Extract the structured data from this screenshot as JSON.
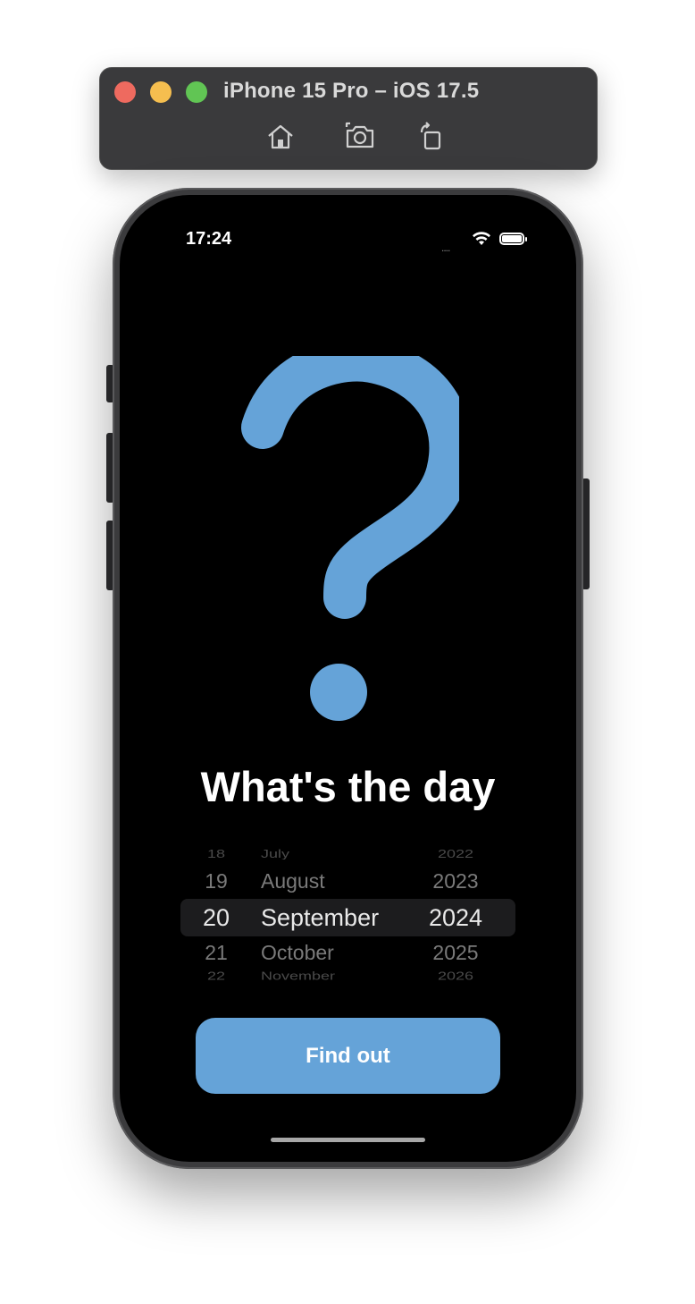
{
  "simulator": {
    "title": "iPhone 15 Pro – iOS 17.5",
    "toolbar": [
      "home-icon",
      "screenshot-icon",
      "rotate-icon"
    ]
  },
  "status_bar": {
    "time": "17:24",
    "signal_dots": "....",
    "icons": [
      "wifi-icon",
      "battery-icon"
    ]
  },
  "main": {
    "hero_icon": "question-mark-icon",
    "accent_color": "#65a3d8",
    "title": "What's the day",
    "button_label": "Find out"
  },
  "date_picker": {
    "rows": [
      {
        "day": "18",
        "month": "July",
        "year": "2022"
      },
      {
        "day": "19",
        "month": "August",
        "year": "2023"
      },
      {
        "day": "20",
        "month": "September",
        "year": "2024"
      },
      {
        "day": "21",
        "month": "October",
        "year": "2025"
      },
      {
        "day": "22",
        "month": "November",
        "year": "2026"
      }
    ],
    "selected": {
      "day": "20",
      "month": "September",
      "year": "2024"
    }
  }
}
